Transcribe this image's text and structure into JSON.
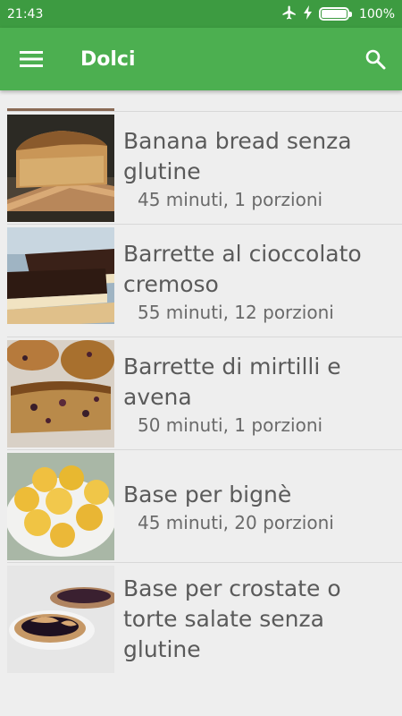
{
  "status": {
    "time": "21:43",
    "battery": "100%"
  },
  "appbar": {
    "title": "Dolci"
  },
  "recipes": [
    {
      "title": "Banana bread senza glutine",
      "meta": "45 minuti, 1 porzioni"
    },
    {
      "title": "Barrette al cioccolato cremoso",
      "meta": "55 minuti, 12 porzioni"
    },
    {
      "title": "Barrette di mirtilli e avena",
      "meta": "50 minuti, 1 porzioni"
    },
    {
      "title": "Base per bignè",
      "meta": "45 minuti, 20 porzioni"
    },
    {
      "title": "Base per crostate o torte salate senza glutine",
      "meta": ""
    }
  ],
  "colors": {
    "statusbar": "#3d9b41",
    "appbar": "#4caf50",
    "background": "#eeeeee"
  },
  "icons": [
    "airplane-icon",
    "charging-icon",
    "battery-icon",
    "menu-icon",
    "search-icon"
  ]
}
